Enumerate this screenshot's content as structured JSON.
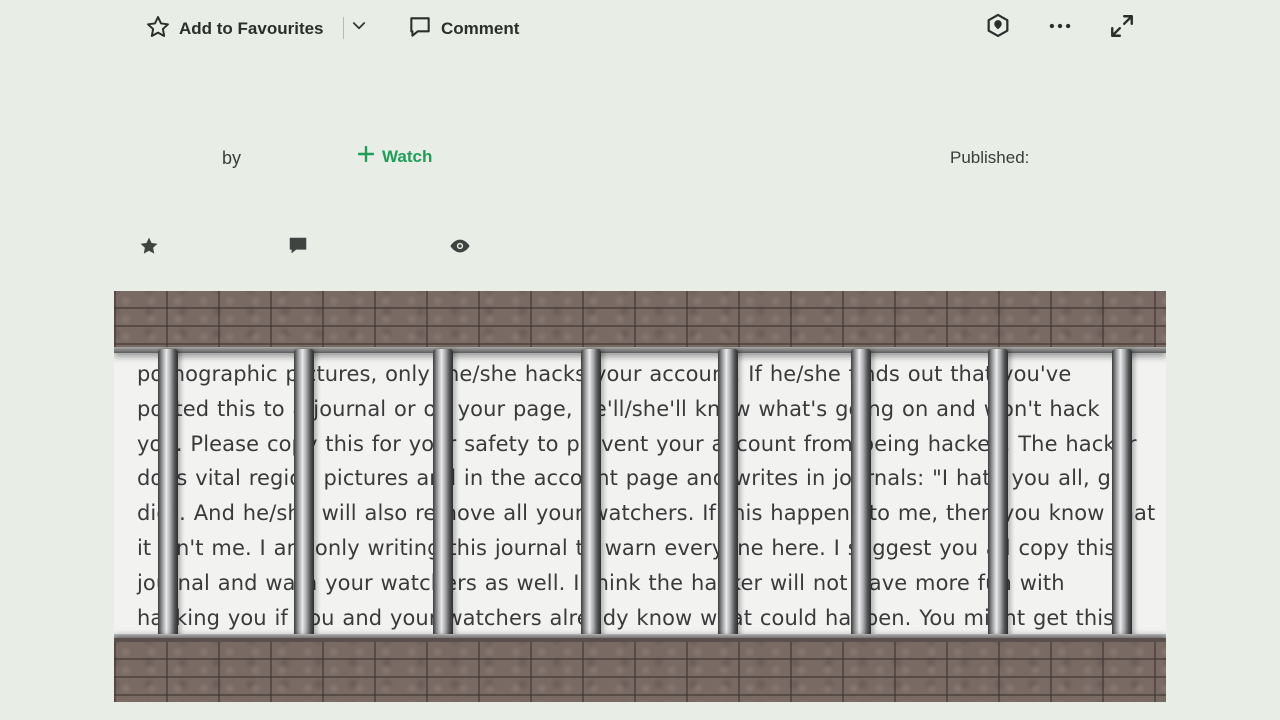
{
  "toolbar": {
    "favourite_label": "Add to Favourites",
    "comment_label": "Comment"
  },
  "deviation": {
    "by_label": "by",
    "watch_label": "Watch",
    "published_label": "Published:"
  },
  "icons": {
    "favourite": "star-outline-icon",
    "dropdown": "chevron-down-icon",
    "comment": "speech-bubble-icon",
    "share": "share-icon",
    "more": "more-options-icon",
    "expand": "expand-icon",
    "watch": "plus-icon",
    "stat_favourites": "star-filled-icon",
    "stat_comments": "comment-filled-icon",
    "stat_views": "eye-icon"
  },
  "colors": {
    "background": "#e8ede6",
    "watch": "#1f9e57",
    "text": "#2b2f2c"
  },
  "artwork": {
    "lines": [
      "pornographic pictures, only the/she hacks your account. If he/she finds out that you've",
      "posted this to a journal or on your page, he'll/she'll know what's going on and won't hack",
      "you. Please copy this for your safety to prevent your account from being hacked. The hacker",
      "does vital region pictures and in the account page and writes in journals: \"I hate you all, go",
      "die\". And he/she will also remove all your watchers. If this happens to me, then you know that",
      "it isn't me. I am only writing this journal to warn everyone here. I suggest you all copy this",
      "journal and warn your watchers as well. I think the hacker will not have more fun with",
      "hacking you if you and your watchers already know what could happen. You might get this"
    ]
  }
}
